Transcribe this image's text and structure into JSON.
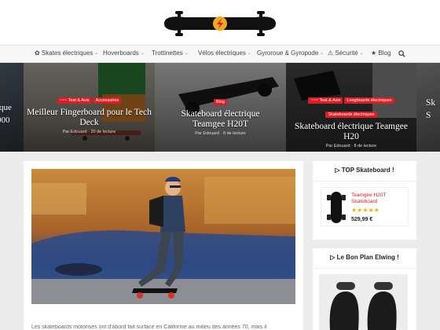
{
  "nav": [
    {
      "label": "✿ Skates électriques",
      "chevron": true
    },
    {
      "label": "Hoverboards",
      "chevron": true
    },
    {
      "label": "Trottinettes",
      "chevron": true
    },
    {
      "label": "Vélos électriques",
      "chevron": true
    },
    {
      "label": "Gyroroue & Gyropode",
      "chevron": true
    },
    {
      "label": "⚠ Sécurité",
      "chevron": true
    },
    {
      "label": "★ Blog",
      "chevron": false
    }
  ],
  "nav_chevron": "⌄",
  "search_icon": "search-icon",
  "slides": [
    {
      "partial_title": "ique",
      "partial_sub": "000"
    },
    {
      "cats": [
        "~~~ Test & Avis",
        "Accessoires"
      ],
      "title": "Meilleur Fingerboard pour le Tech Deck",
      "meta": "Par Edouard · 20 de lecture"
    },
    {
      "cats": [
        "Blog"
      ],
      "title": "Skateboard électrique Teamgee H20T",
      "meta": "Par Edouard · 8 de lecture"
    },
    {
      "cats": [
        "~~~ Test & Avis",
        "Longboards électriques",
        "Skateboards électriques"
      ],
      "title": "Skateboard électrique Teamgee H20",
      "meta": "Par Edouard · 8 de lecture"
    },
    {
      "partial_title": "Sk",
      "partial_sub": "S"
    }
  ],
  "widget_top": {
    "title": "▷ TOP Skateboard !",
    "product_name": "Teamgee H20T Skateboard",
    "rating": "★★★★★",
    "price": "529,99 €"
  },
  "widget_plan": {
    "title": "▷ Le Bon Plan Elwing !"
  },
  "intro_text": "Les skateboards motorisés ont d'abord fait surface en Californie au milieu des années 70, mais il",
  "colors": {
    "accent": "#d81f26",
    "star": "#f2a81d"
  }
}
